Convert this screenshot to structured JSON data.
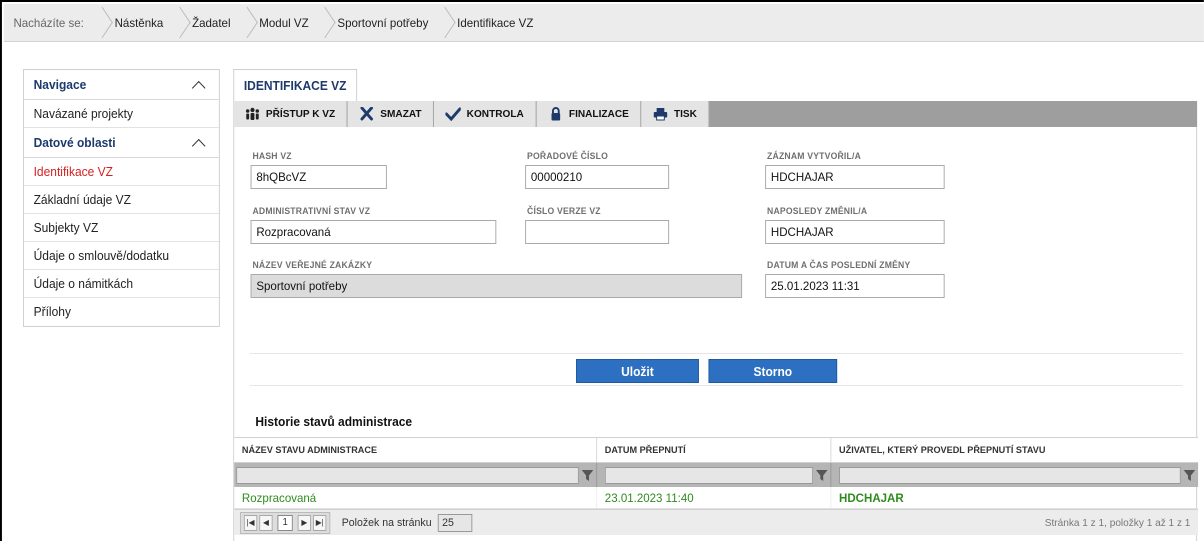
{
  "breadcrumb": {
    "lead": "Nacházíte se:",
    "items": [
      "Nástěnka",
      "Žadatel",
      "Modul VZ",
      "Sportovní potřeby",
      "Identifikace VZ"
    ]
  },
  "sidebar": {
    "nav_title": "Navigace",
    "nav_items": [
      "Navázané projekty"
    ],
    "data_title": "Datové oblasti",
    "data_items": [
      "Identifikace VZ",
      "Základní údaje VZ",
      "Subjekty VZ",
      "Údaje o smlouvě/dodatku",
      "Údaje o námitkách",
      "Přílohy"
    ],
    "active": "Identifikace VZ"
  },
  "tab": {
    "label": "IDENTIFIKACE VZ"
  },
  "toolbar": {
    "access": "PŘÍSTUP K VZ",
    "delete": "SMAZAT",
    "check": "KONTROLA",
    "finalize": "FINALIZACE",
    "print": "TISK"
  },
  "form": {
    "hash_label": "HASH VZ",
    "hash_value": "8hQBcVZ",
    "order_label": "POŘADOVÉ ČÍSLO",
    "order_value": "00000210",
    "created_label": "ZÁZNAM VYTVOŘIL/A",
    "created_value": "HDCHAJAR",
    "admin_label": "ADMINISTRATIVNÍ STAV VZ",
    "admin_value": "Rozpracovaná",
    "version_label": "ČÍSLO VERZE VZ",
    "version_value": "",
    "changed_label": "NAPOSLEDY ZMĚNIL/A",
    "changed_value": "HDCHAJAR",
    "name_label": "NÁZEV VEŘEJNÉ ZAKÁZKY",
    "name_value": "Sportovní potřeby",
    "datetime_label": "DATUM A ČAS POSLEDNÍ ZMĚNY",
    "datetime_value": "25.01.2023 11:31"
  },
  "actions": {
    "save": "Uložit",
    "cancel": "Storno"
  },
  "history": {
    "title": "Historie stavů administrace",
    "columns": [
      "NÁZEV STAVU ADMINISTRACE",
      "DATUM PŘEPNUTÍ",
      "UŽIVATEL, KTERÝ PROVEDL PŘEPNUTÍ STAVU"
    ],
    "rows": [
      {
        "state": "Rozpracovaná",
        "date": "23.01.2023 11:40",
        "user": "HDCHAJAR"
      }
    ]
  },
  "pager": {
    "page": "1",
    "per_page_label": "Položek na stránku",
    "per_page": "25",
    "summary": "Stránka 1 z 1, položky 1 až 1 z 1"
  }
}
